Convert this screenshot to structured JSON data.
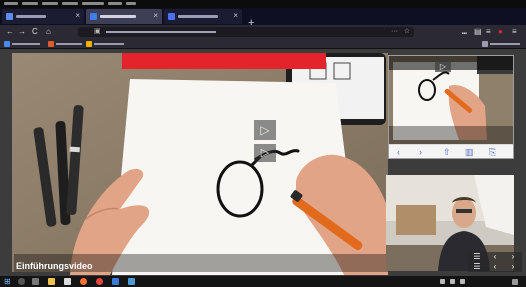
{
  "browser": {
    "menu_items": [
      "",
      "",
      "",
      "",
      "",
      "",
      ""
    ],
    "tabs": [
      {
        "title": "",
        "favicon_color": "#5b8def",
        "active": false
      },
      {
        "title": "",
        "favicon_color": "#3d7df0",
        "active": true
      },
      {
        "title": "",
        "favicon_color": "#4a6ff0",
        "active": false
      }
    ],
    "close_glyph": "×",
    "new_tab_glyph": "+",
    "nav": {
      "back": "←",
      "forward": "→",
      "reload": "C",
      "home": "⌂"
    },
    "url": "",
    "url_icons": {
      "menu": "···",
      "star": "☆"
    },
    "toolbar_icons": [
      "⑉",
      "▤",
      "≡",
      "⚠",
      "≡"
    ],
    "bookmarks": [
      {
        "label": "",
        "color": "#4a8af0"
      },
      {
        "label": "",
        "color": "#e05a30"
      },
      {
        "label": "",
        "color": "#f5b000"
      },
      {
        "label": "",
        "color": "#9b9bb0"
      }
    ]
  },
  "video": {
    "title": "Einführungsvideo",
    "play_glyph": "▷",
    "controls": [
      "☰",
      "‹",
      "›"
    ]
  },
  "pip": {
    "controls": [
      "‹",
      "›",
      "⇧",
      "▥",
      "⎘"
    ]
  },
  "colors": {
    "accent_red": "#e3242b",
    "paper": "#f7f6f2",
    "desk": "#8a7a66",
    "marker": "#e26a1c"
  },
  "taskbar": {
    "start": "⊞",
    "clock": ""
  }
}
